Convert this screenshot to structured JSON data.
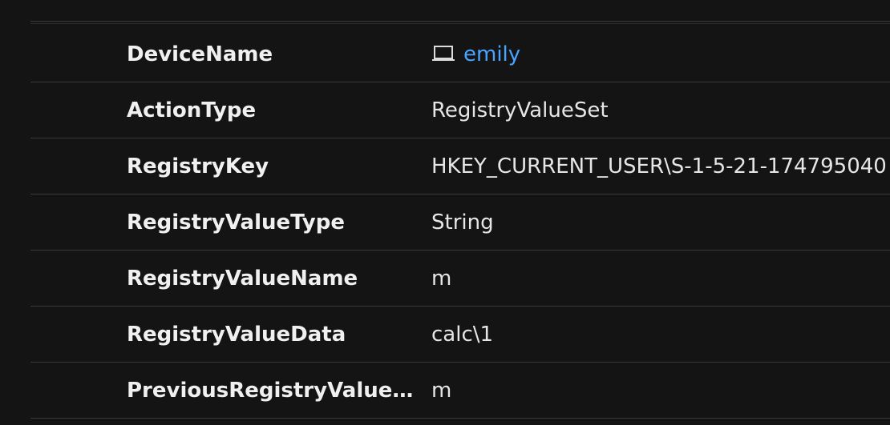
{
  "rows": [
    {
      "key": "DeviceName",
      "value": "emily",
      "value_is_link": true,
      "icon": "laptop-icon"
    },
    {
      "key": "ActionType",
      "value": "RegistryValueSet"
    },
    {
      "key": "RegistryKey",
      "value": "HKEY_CURRENT_USER\\S-1-5-21-174795040"
    },
    {
      "key": "RegistryValueType",
      "value": "String"
    },
    {
      "key": "RegistryValueName",
      "value": "m"
    },
    {
      "key": "RegistryValueData",
      "value": "calc\\1"
    },
    {
      "key": "PreviousRegistryValueNa...",
      "value": "m"
    }
  ],
  "colors": {
    "background": "#141414",
    "link": "#4aa3ff",
    "divider": "#3a3a3a"
  }
}
